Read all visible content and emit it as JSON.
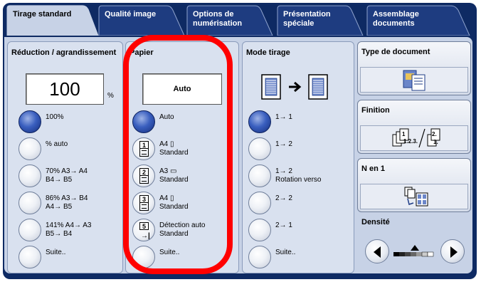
{
  "tabs": [
    {
      "label": "Tirage standard",
      "active": true
    },
    {
      "label": "Qualité image",
      "active": false
    },
    {
      "label": "Options de\nnumérisation",
      "active": false
    },
    {
      "label": "Présentation\nspéciale",
      "active": false
    },
    {
      "label": "Assemblage\ndocuments",
      "active": false
    }
  ],
  "reduction": {
    "title": "Réduction / agrandissement",
    "value": "100",
    "unit": "%",
    "options": [
      {
        "label": "100%",
        "selected": true
      },
      {
        "label": "% auto",
        "selected": false
      },
      {
        "label": "70% A3→ A4\nB4→ B5",
        "selected": false
      },
      {
        "label": "86% A3→ B4\nA4→ B5",
        "selected": false
      },
      {
        "label": "141% A4→ A3\nB5→ B4",
        "selected": false
      },
      {
        "label": "Suite..",
        "selected": false
      }
    ]
  },
  "papier": {
    "title": "Papier",
    "value": "Auto",
    "options": [
      {
        "label": "Auto",
        "icon": "radio",
        "selected": true
      },
      {
        "label": "A4 ▯\nStandard",
        "icon": "tray-1-icon",
        "tray": "1"
      },
      {
        "label": "A3 ▭\nStandard",
        "icon": "tray-2-icon",
        "tray": "2"
      },
      {
        "label": "A4 ▯\nStandard",
        "icon": "tray-3-icon",
        "tray": "3"
      },
      {
        "label": "Détection auto\nStandard",
        "icon": "tray-5-icon",
        "tray": "5"
      },
      {
        "label": "Suite..",
        "icon": "radio",
        "selected": false
      }
    ]
  },
  "mode": {
    "title": "Mode tirage",
    "options": [
      {
        "label": "1→ 1",
        "selected": true
      },
      {
        "label": "1→ 2",
        "selected": false
      },
      {
        "label": "1→ 2\nRotation verso",
        "selected": false
      },
      {
        "label": "2→ 2",
        "selected": false
      },
      {
        "label": "2→ 1",
        "selected": false
      },
      {
        "label": "Suite..",
        "selected": false
      }
    ]
  },
  "side": {
    "type_doc": "Type de document",
    "finition": "Finition",
    "finition_icon_text_1": "1",
    "finition_icon_text_2": "2",
    "finition_icon_text_3": "1.2.3.",
    "finition_icon_text_4": "2.",
    "finition_icon_text_5": "1.",
    "n_en_1": "N en 1",
    "densite": "Densité"
  },
  "colors": {
    "frame": "#0e2a63",
    "panel": "#d9e1ef",
    "highlight": "#ff0000",
    "selected_radio": "#3a5fbf"
  }
}
